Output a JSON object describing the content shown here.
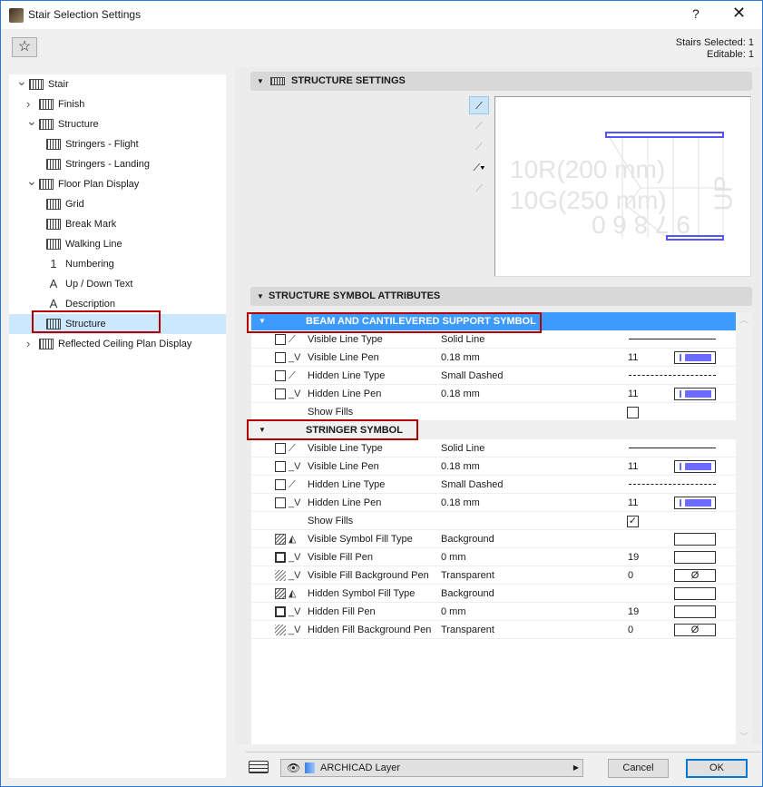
{
  "window": {
    "title": "Stair Selection Settings",
    "help": "?",
    "close": "✕"
  },
  "toolbar": {
    "favorites_icon": "star-icon",
    "favorites": "☆"
  },
  "selection": {
    "stairs_selected": "Stairs Selected: 1",
    "editable": "Editable: 1"
  },
  "tree": [
    {
      "label": "Stair",
      "level": 0,
      "chevron": "down",
      "icon": "stair-icon"
    },
    {
      "label": "Finish",
      "level": 1,
      "chevron": "right",
      "icon": "stair-icon"
    },
    {
      "label": "Structure",
      "level": 1,
      "chevron": "down",
      "icon": "stair-structure-icon"
    },
    {
      "label": "Stringers - Flight",
      "level": 2,
      "icon": "stringer-flight-icon"
    },
    {
      "label": "Stringers - Landing",
      "level": 2,
      "icon": "stringer-landing-icon"
    },
    {
      "label": "Floor Plan Display",
      "level": 1,
      "chevron": "down",
      "icon": "floor-plan-icon"
    },
    {
      "label": "Grid",
      "level": 2,
      "icon": "grid-icon"
    },
    {
      "label": "Break Mark",
      "level": 2,
      "icon": "break-mark-icon"
    },
    {
      "label": "Walking Line",
      "level": 2,
      "icon": "walking-line-icon"
    },
    {
      "label": "Numbering",
      "level": 2,
      "icon": "numbering-icon",
      "glyph": "1"
    },
    {
      "label": "Up / Down Text",
      "level": 2,
      "icon": "text-icon",
      "glyph": "A"
    },
    {
      "label": "Description",
      "level": 2,
      "icon": "text-icon",
      "glyph": "A"
    },
    {
      "label": "Structure",
      "level": 2,
      "icon": "structure-icon",
      "selected": true
    },
    {
      "label": "Reflected Ceiling Plan Display",
      "level": 1,
      "chevron": "right",
      "icon": "ceiling-plan-icon"
    }
  ],
  "structure_settings": {
    "title": "STRUCTURE SETTINGS",
    "preview_text": [
      "10R(200 mm)",
      "10G(250 mm)",
      "UP",
      "9 7 8 6 0"
    ]
  },
  "structure_symbol": {
    "title": "STRUCTURE SYMBOL ATTRIBUTES",
    "groups": [
      {
        "title": "BEAM AND CANTILEVERED SUPPORT SYMBOL",
        "active": true,
        "rows": [
          {
            "label": "Visible Line Type",
            "value": "Solid Line",
            "kind": "line",
            "icon": "line-type-icon"
          },
          {
            "label": "Visible Line Pen",
            "value": "0.18 mm",
            "number": "11",
            "kind": "pen",
            "icon": "pen-icon"
          },
          {
            "label": "Hidden Line Type",
            "value": "Small Dashed",
            "kind": "dash",
            "icon": "line-type-icon"
          },
          {
            "label": "Hidden Line Pen",
            "value": "0.18 mm",
            "number": "11",
            "kind": "pen",
            "icon": "pen-icon"
          },
          {
            "label": "Show Fills",
            "kind": "check",
            "checked": false
          }
        ]
      },
      {
        "title": "STRINGER SYMBOL",
        "active": false,
        "rows": [
          {
            "label": "Visible Line Type",
            "value": "Solid Line",
            "kind": "line",
            "icon": "line-type-icon"
          },
          {
            "label": "Visible Line Pen",
            "value": "0.18 mm",
            "number": "11",
            "kind": "pen",
            "icon": "pen-icon"
          },
          {
            "label": "Hidden Line Type",
            "value": "Small Dashed",
            "kind": "dash",
            "icon": "line-type-icon"
          },
          {
            "label": "Hidden Line Pen",
            "value": "0.18 mm",
            "number": "11",
            "kind": "pen",
            "icon": "pen-icon"
          },
          {
            "label": "Show Fills",
            "kind": "check",
            "checked": true
          },
          {
            "label": "Visible Symbol Fill Type",
            "value": "Background",
            "kind": "fill",
            "icon": "fill-type-icon",
            "box": "hatch"
          },
          {
            "label": "Visible Fill Pen",
            "value": "0 mm",
            "number": "19",
            "kind": "fill",
            "icon": "pen-icon",
            "box": "thick"
          },
          {
            "label": "Visible Fill Background Pen",
            "value": "Transparent",
            "number": "0",
            "kind": "empty",
            "symbol": "Ø",
            "icon": "pen-icon",
            "box": "hatch2"
          },
          {
            "label": "Hidden Symbol Fill Type",
            "value": "Background",
            "kind": "fill",
            "icon": "fill-type-icon",
            "box": "hatch"
          },
          {
            "label": "Hidden Fill Pen",
            "value": "0 mm",
            "number": "19",
            "kind": "fill",
            "icon": "pen-icon",
            "box": "thick"
          },
          {
            "label": "Hidden Fill Background Pen",
            "value": "Transparent",
            "number": "0",
            "kind": "empty",
            "symbol": "Ø",
            "icon": "pen-icon",
            "box": "hatch2"
          }
        ]
      }
    ]
  },
  "footer": {
    "layer": "ARCHICAD Layer",
    "cancel": "Cancel",
    "ok": "OK"
  },
  "colors": {
    "accent": "#3d9bff",
    "highlight_box": "#b30000",
    "pen": "#6b6bff"
  }
}
